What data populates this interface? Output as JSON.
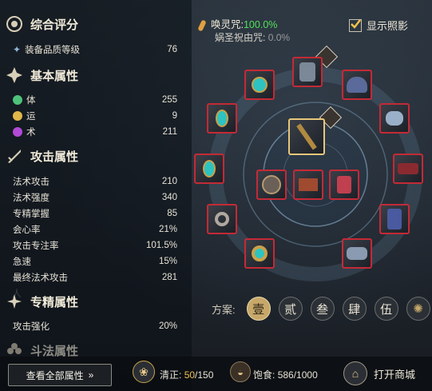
{
  "left": {
    "overall": {
      "title": "综合评分",
      "gear_label": "装备品质等级",
      "gear_value": "76"
    },
    "basic": {
      "title": "基本属性",
      "items": [
        {
          "label": "体",
          "value": "255",
          "color": "#4ec27a"
        },
        {
          "label": "运",
          "value": "9",
          "color": "#e1b84a"
        },
        {
          "label": "术",
          "value": "211",
          "color": "#b24ad6"
        }
      ]
    },
    "attack": {
      "title": "攻击属性",
      "items": [
        {
          "label": "法术攻击",
          "value": "210"
        },
        {
          "label": "法术强度",
          "value": "340"
        },
        {
          "label": "专精掌握",
          "value": "85"
        },
        {
          "label": "会心率",
          "value": "21%"
        },
        {
          "label": "攻击专注率",
          "value": "101.5%"
        },
        {
          "label": "急速",
          "value": "15%"
        },
        {
          "label": "最终法术攻击",
          "value": "281"
        }
      ]
    },
    "mastery": {
      "title": "专精属性",
      "items": [
        {
          "label": "攻击强化",
          "value": "20%"
        }
      ]
    },
    "fight": {
      "title": "斗法属性"
    },
    "view_all": "查看全部属性"
  },
  "header": {
    "summon_label": "唤灵咒:",
    "summon_value": "100.0%",
    "blessing_label": "娲圣祝由咒:",
    "blessing_value": "0.0%",
    "show_photo": "显示照影"
  },
  "plan": {
    "label": "方案:",
    "buttons": [
      "壹",
      "贰",
      "叁",
      "肆",
      "伍"
    ],
    "active": 0
  },
  "footer": {
    "clear_label": "清正:",
    "clear_value": "50",
    "clear_max": "/150",
    "food_label": "饱食:",
    "food_value": "586/1000",
    "shop": "打开商城"
  },
  "colors": {
    "accent": "#e7c77a",
    "slot_border": "#c42a36",
    "green": "#52e05a"
  }
}
